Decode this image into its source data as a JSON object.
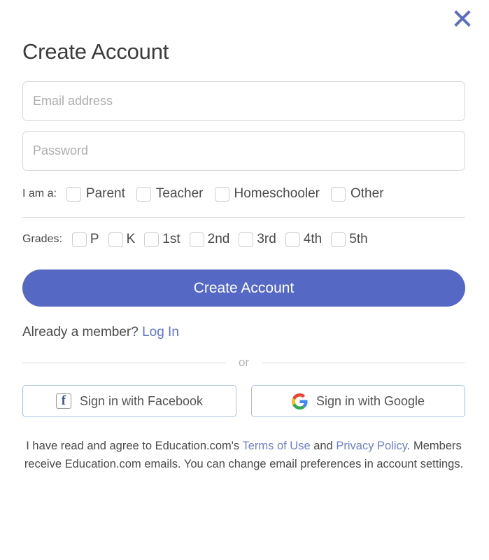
{
  "dialog": {
    "title": "Create Account",
    "close_icon": "close-x-icon"
  },
  "form": {
    "email": {
      "placeholder": "Email address",
      "value": ""
    },
    "password": {
      "placeholder": "Password",
      "value": ""
    },
    "role": {
      "label": "I am a:",
      "options": [
        {
          "label": "Parent",
          "checked": false
        },
        {
          "label": "Teacher",
          "checked": false
        },
        {
          "label": "Homeschooler",
          "checked": false
        },
        {
          "label": "Other",
          "checked": false
        }
      ]
    },
    "grades": {
      "label": "Grades:",
      "options": [
        {
          "label": "P",
          "checked": false
        },
        {
          "label": "K",
          "checked": false
        },
        {
          "label": "1st",
          "checked": false
        },
        {
          "label": "2nd",
          "checked": false
        },
        {
          "label": "3rd",
          "checked": false
        },
        {
          "label": "4th",
          "checked": false
        },
        {
          "label": "5th",
          "checked": false
        }
      ]
    },
    "submit_label": "Create Account"
  },
  "member": {
    "prompt": "Already a member?",
    "login_label": "Log In"
  },
  "divider": {
    "or_label": "or"
  },
  "social": {
    "facebook": {
      "label": "Sign in with Facebook",
      "icon": "facebook-icon",
      "glyph": "f"
    },
    "google": {
      "label": "Sign in with Google",
      "icon": "google-icon"
    }
  },
  "footer": {
    "line1_prefix": "I have read and agree to Education.com's",
    "terms_label": "Terms of Use",
    "line1_mid": "and",
    "privacy_label": "Privacy Policy",
    "line1_suffix": ".",
    "line2": "Members receive Education.com emails. You can change email preferences in account settings."
  },
  "colors": {
    "primary": "#5468c4",
    "link": "#5f74c6",
    "close": "#5b6cc0",
    "border": "#d8d8d8",
    "social_border": "#a9c2e2"
  }
}
